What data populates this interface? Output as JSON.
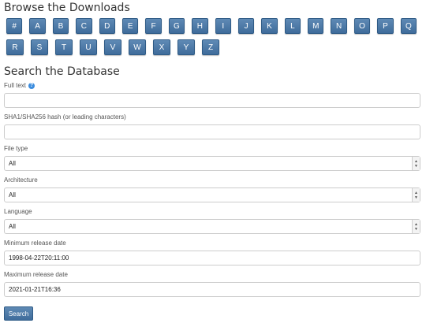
{
  "browse": {
    "title": "Browse the Downloads",
    "row1": [
      "#",
      "A",
      "B",
      "C",
      "D",
      "E",
      "F",
      "G",
      "H",
      "I",
      "J",
      "K",
      "L",
      "M",
      "N",
      "O",
      "P",
      "Q"
    ],
    "row2": [
      "R",
      "S",
      "T",
      "U",
      "V",
      "W",
      "X",
      "Y",
      "Z"
    ]
  },
  "search": {
    "title": "Search the Database",
    "full_text": {
      "label": "Full text",
      "value": "",
      "help_icon": "question-circle-icon"
    },
    "hash": {
      "label": "SHA1/SHA256 hash (or leading characters)",
      "value": ""
    },
    "file_type": {
      "label": "File type",
      "selected": "All"
    },
    "architecture": {
      "label": "Architecture",
      "selected": "All"
    },
    "language": {
      "label": "Language",
      "selected": "All"
    },
    "min_date": {
      "label": "Minimum release date",
      "value": "1998-04-22T20:11:00"
    },
    "max_date": {
      "label": "Maximum release date",
      "value": "2021-01-21T16:36"
    },
    "submit_label": "Search"
  },
  "colors": {
    "button_bg": "#4a77a6",
    "button_border": "#2f5b86",
    "help_icon": "#3c8dde"
  }
}
